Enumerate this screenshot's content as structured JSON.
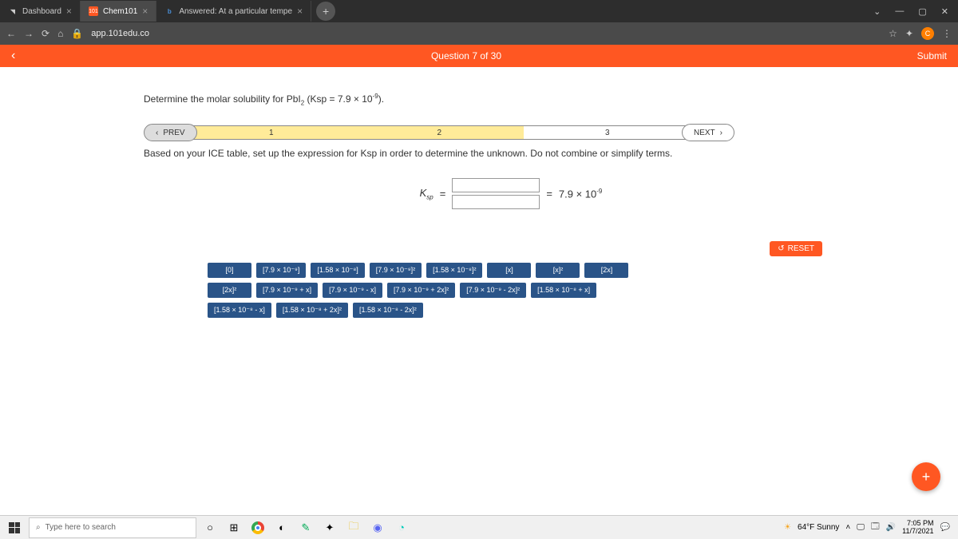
{
  "tabs": [
    {
      "label": "Dashboard"
    },
    {
      "label": "Chem101"
    },
    {
      "label": "Answered: At a particular tempe"
    }
  ],
  "url": {
    "domain": "app.101edu.co"
  },
  "header": {
    "counter": "Question 7 of 30",
    "submit": "Submit"
  },
  "prompt_prefix": "Determine the molar solubility for PbI",
  "prompt_sub": "2",
  "prompt_mid": " (Ksp = 7.9 × 10",
  "prompt_sup": "-9",
  "prompt_suffix": ").",
  "nav": {
    "prev": "PREV",
    "next": "NEXT",
    "steps": [
      "1",
      "2",
      "3"
    ]
  },
  "instruction": "Based on your ICE table, set up the expression for Ksp in order to determine the unknown. Do not combine or simplify terms.",
  "equation": {
    "ksp": "K",
    "ksp_sub": "sp",
    "eq1": "=",
    "eq2": "=",
    "rhs_val": "7.9 × 10",
    "rhs_sup": "-9"
  },
  "reset": "RESET",
  "tiles": [
    "[0]",
    "[7.9 × 10⁻⁹]",
    "[1.58 × 10⁻⁸]",
    "[7.9 × 10⁻⁹]²",
    "[1.58 × 10⁻⁸]²",
    "[x]",
    "[x]²",
    "[2x]",
    "[2x]²",
    "[7.9 × 10⁻⁹ + x]",
    "[7.9 × 10⁻⁹ - x]",
    "[7.9 × 10⁻⁹ + 2x]²",
    "[7.9 × 10⁻⁹ - 2x]²",
    "[1.58 × 10⁻⁸ + x]",
    "[1.58 × 10⁻⁸ - x]",
    "[1.58 × 10⁻⁸ + 2x]²",
    "[1.58 × 10⁻⁸ - 2x]²"
  ],
  "taskbar": {
    "search": "Type here to search",
    "weather": "64°F Sunny",
    "time": "7:05 PM",
    "date": "11/7/2021"
  }
}
